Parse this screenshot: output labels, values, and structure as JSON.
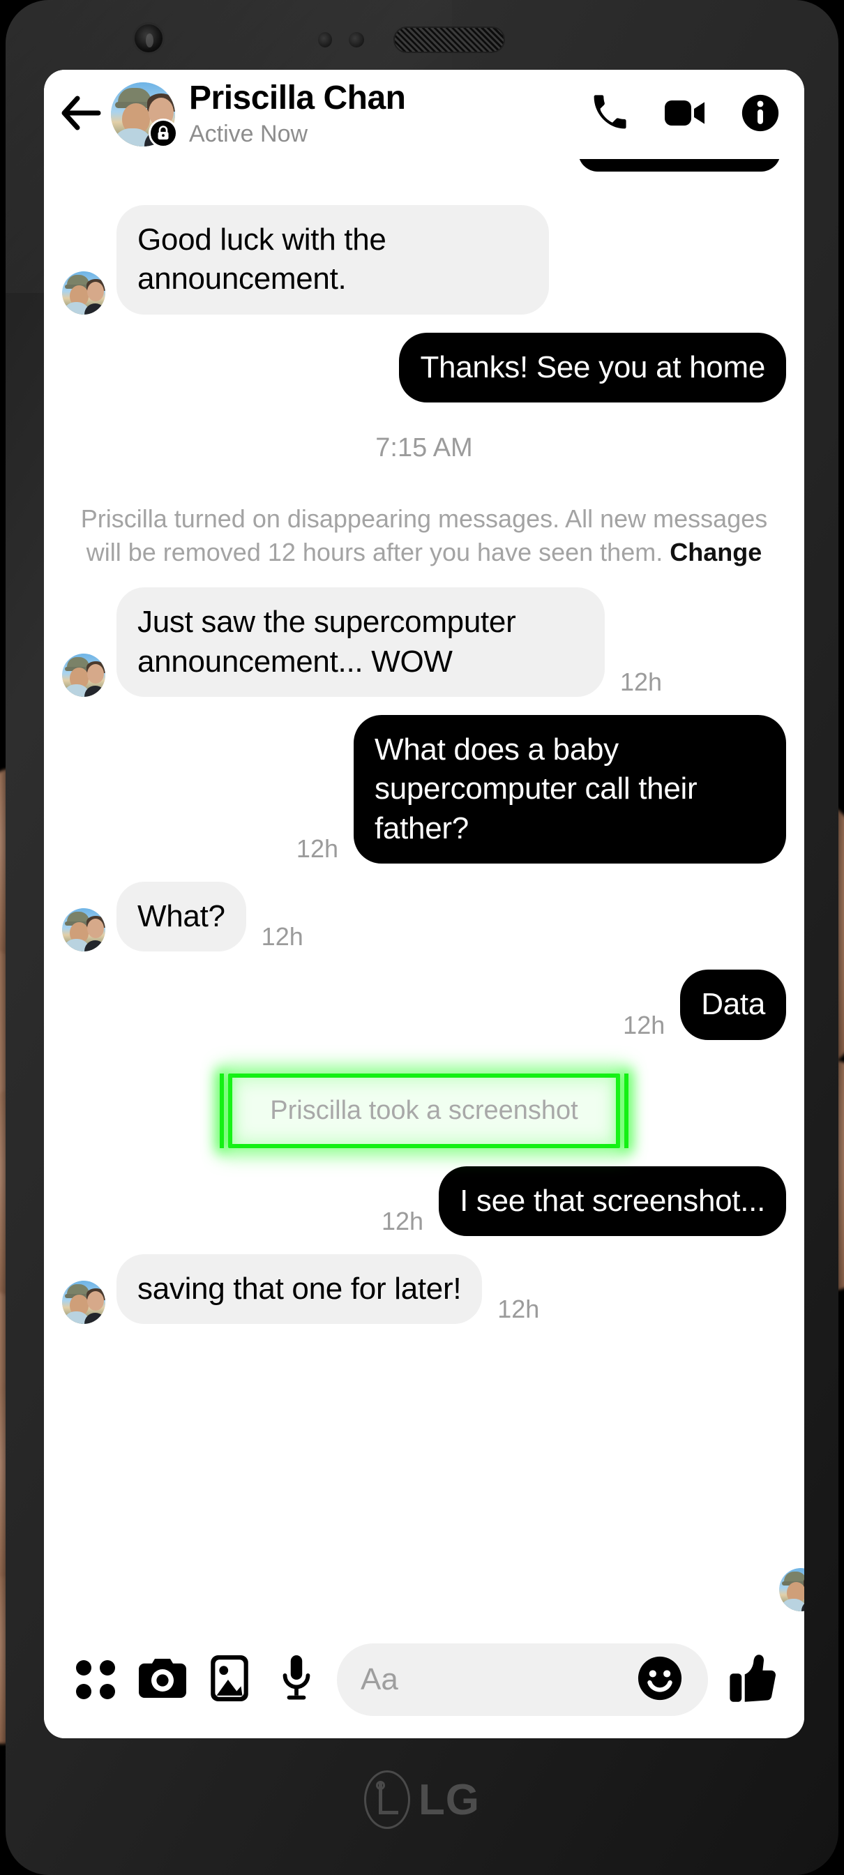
{
  "device": {
    "brand_label": "LG",
    "hardware": {
      "front_camera": "front-camera",
      "earpiece": "earpiece-speaker"
    }
  },
  "header": {
    "back_icon": "back-arrow-icon",
    "avatar": "contact-avatar",
    "lock_badge": "lock-icon",
    "name": "Priscilla Chan",
    "status": "Active Now",
    "actions": [
      {
        "icon": "phone-icon",
        "label": "Audio call"
      },
      {
        "icon": "video-camera-icon",
        "label": "Video call"
      },
      {
        "icon": "info-icon",
        "label": "Conversation info"
      }
    ]
  },
  "conversation": {
    "time_divider": "7:15 AM",
    "system_note": {
      "text": "Priscilla turned on disappearing messages. All new messages will be removed 12 hours after you have seen them. ",
      "action": "Change"
    },
    "screenshot_notice": {
      "text": "Priscilla took a screenshot",
      "highlight_color": "#14f014"
    },
    "messages": [
      {
        "sender": "them",
        "text": "Good luck with the announcement.",
        "timestamp": ""
      },
      {
        "sender": "me",
        "text": "Thanks! See you at home",
        "timestamp": ""
      },
      {
        "sender": "them",
        "text": "Just saw the supercomputer announcement... WOW",
        "timestamp": "12h"
      },
      {
        "sender": "me",
        "text": "What does a baby supercomputer call their father?",
        "timestamp": "12h"
      },
      {
        "sender": "them",
        "text": "What?",
        "timestamp": "12h"
      },
      {
        "sender": "me",
        "text": "Data",
        "timestamp": "12h"
      },
      {
        "sender": "me",
        "text": "I see that screenshot...",
        "timestamp": "12h"
      },
      {
        "sender": "them",
        "text": "saving that one for later!",
        "timestamp": "12h"
      }
    ]
  },
  "composer": {
    "actions": [
      {
        "icon": "apps-grid-icon"
      },
      {
        "icon": "camera-icon"
      },
      {
        "icon": "photo-gallery-icon"
      },
      {
        "icon": "microphone-icon"
      }
    ],
    "input_placeholder": "Aa",
    "emoji_icon": "smiley-icon",
    "like_icon": "thumbs-up-icon"
  },
  "colors": {
    "incoming_bubble": "#f0f0f0",
    "outgoing_bubble": "#000000",
    "timestamp": "#9b9b9b",
    "highlight": "#14f014"
  }
}
